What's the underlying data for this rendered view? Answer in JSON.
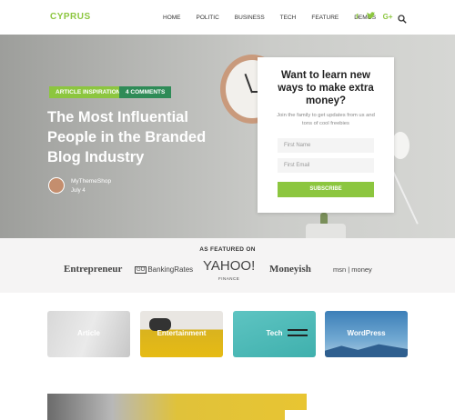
{
  "header": {
    "logo": "CYPRUS",
    "nav": [
      "HOME",
      "POLITIC",
      "BUSINESS",
      "TECH",
      "FEATURE",
      "DEMOS"
    ],
    "social": {
      "facebook": "f",
      "twitter": "t",
      "google": "G+"
    }
  },
  "hero": {
    "tags": [
      "ARTICLE INSPIRATION",
      "4 COMMENTS"
    ],
    "title": "The Most Influential People in the Branded Blog Industry",
    "author": "MyThemeShop",
    "date": "July 4"
  },
  "signup": {
    "title": "Want to learn new ways to make extra money?",
    "text": "Join the family to get updates from us and tons of cool freebies",
    "first_name_placeholder": "First Name",
    "email_placeholder": "First Email",
    "button": "SUBSCRIBE"
  },
  "featured": {
    "label": "AS FEATURED ON",
    "brands": {
      "entrepreneur": "Entrepreneur",
      "gobankingrates_go": "GO",
      "gobankingrates": "BankingRates",
      "yahoo": "YAHOO!",
      "yahoo_sub": "FINANCE",
      "moneyish": "Moneyish",
      "msn": "msn | money"
    }
  },
  "categories": [
    "Article",
    "Entertainment",
    "Tech",
    "WordPress"
  ],
  "colors": {
    "accent": "#8cc63f",
    "tag2": "#2e8b57"
  },
  "icons": [
    "search-icon",
    "facebook-icon",
    "twitter-icon",
    "google-plus-icon"
  ]
}
